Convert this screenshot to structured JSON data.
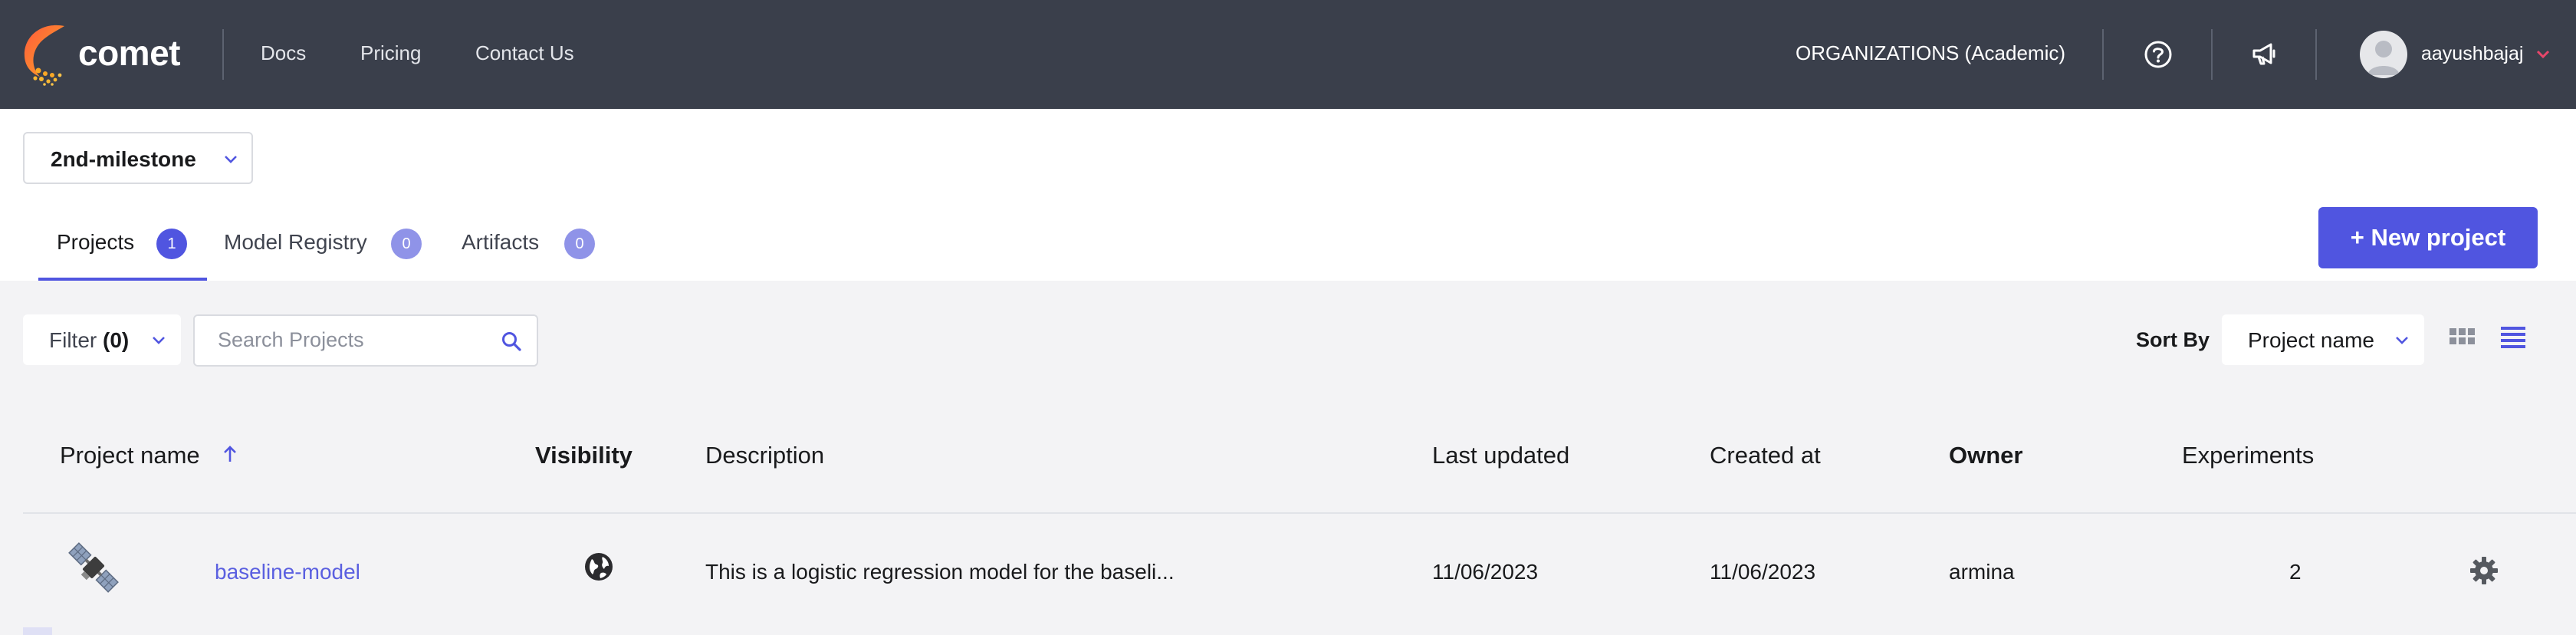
{
  "navbar": {
    "logo_text": "comet",
    "links": [
      "Docs",
      "Pricing",
      "Contact Us"
    ],
    "organization": "ORGANIZATIONS (Academic)",
    "username": "aayushbajaj",
    "icons": [
      "help-icon",
      "announcement-icon",
      "avatar",
      "chevron-down-icon"
    ]
  },
  "workspace": {
    "selected": "2nd-milestone"
  },
  "tabs": [
    {
      "label": "Projects",
      "count": "1",
      "active": true
    },
    {
      "label": "Model Registry",
      "count": "0",
      "active": false
    },
    {
      "label": "Artifacts",
      "count": "0",
      "active": false
    }
  ],
  "new_project_label": "+ New project",
  "toolbar": {
    "filter_label": "Filter",
    "filter_count": "(0)",
    "search_placeholder": "Search Projects",
    "sort_by_label": "Sort By",
    "sort_value": "Project name",
    "view_icons": [
      "grid-view-icon",
      "list-view-icon"
    ]
  },
  "table": {
    "headers": [
      "Project name",
      "Visibility",
      "Description",
      "Last updated",
      "Created at",
      "Owner",
      "Experiments"
    ],
    "rows": [
      {
        "name": "baseline-model",
        "visibility": "public",
        "description": "This is a logistic regression model for the baseli...",
        "last_updated": "11/06/2023",
        "created_at": "11/06/2023",
        "owner": "armina",
        "experiments": "2"
      }
    ]
  },
  "colors": {
    "navbar_bg": "#3a3f4b",
    "accent": "#5055e0",
    "badge_inactive": "#8f93e8",
    "link": "#5a5fe0"
  }
}
